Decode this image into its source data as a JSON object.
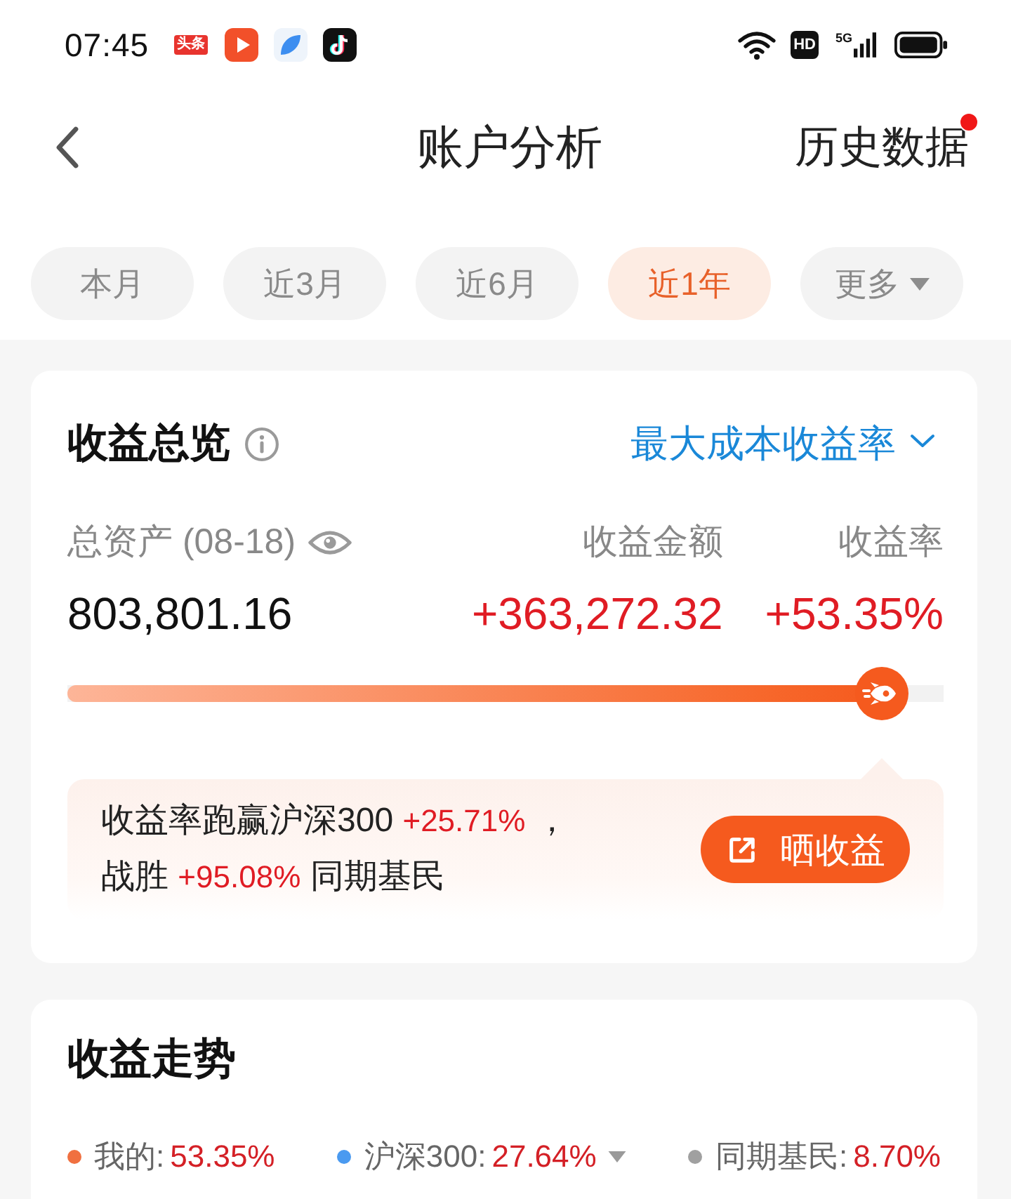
{
  "status_bar": {
    "time": "07:45",
    "news_app_label": "头条",
    "hd_label": "HD",
    "network_label": "5G"
  },
  "nav": {
    "title": "账户分析",
    "history_link": "历史数据",
    "history_badge": true
  },
  "period_tabs": [
    {
      "label": "本月",
      "selected": false,
      "kind": "period"
    },
    {
      "label": "近3月",
      "selected": false,
      "kind": "period"
    },
    {
      "label": "近6月",
      "selected": false,
      "kind": "period"
    },
    {
      "label": "近1年",
      "selected": true,
      "kind": "period"
    },
    {
      "label": "更多",
      "selected": false,
      "kind": "dropdown"
    }
  ],
  "overview": {
    "title": "收益总览",
    "metric_selector": "最大成本收益率",
    "assets_label": "总资产 (08-18)",
    "assets_value": "803,801.16",
    "profit_label": "收益金额",
    "profit_value": "+363,272.32",
    "rate_label": "收益率",
    "rate_value": "+53.35%",
    "progress": {
      "level": 0.93
    },
    "summary_lines": [
      "收益率跑赢沪深300 **+25.71%** ，",
      "战胜 **+95.08%** 同期基民"
    ],
    "share_button": "晒收益"
  },
  "trend": {
    "title": "收益走势",
    "legend": [
      {
        "label": "我的:",
        "value": "53.35%",
        "color": "#f07040",
        "has_menu": false
      },
      {
        "label": "沪深300:",
        "value": "27.64%",
        "color": "#4a9af0",
        "has_menu": true
      },
      {
        "label": "同期基民:",
        "value": "8.70%",
        "color": "#a0a0a0",
        "has_menu": false
      }
    ]
  }
}
